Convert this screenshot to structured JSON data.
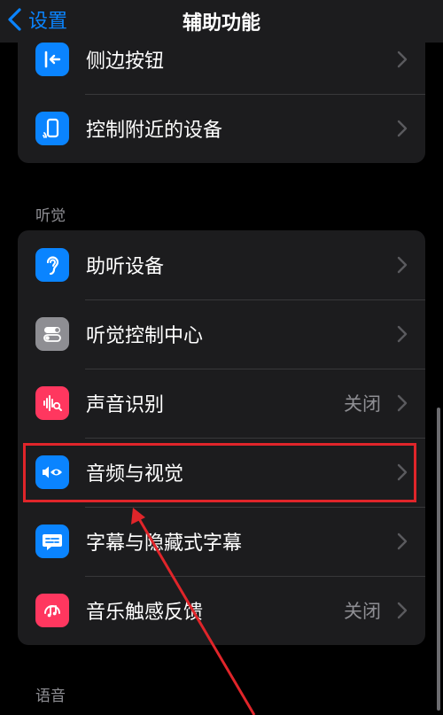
{
  "navbar": {
    "back_label": "设置",
    "title": "辅助功能"
  },
  "group_top": [
    {
      "label": "侧边按钮",
      "value": "",
      "icon": "side-button-icon",
      "color": "#0a84ff"
    },
    {
      "label": "控制附近的设备",
      "value": "",
      "icon": "nearby-devices-icon",
      "color": "#0a84ff"
    }
  ],
  "hearing": {
    "header": "听觉",
    "items": [
      {
        "label": "助听设备",
        "value": "",
        "icon": "ear-icon",
        "color": "#0a84ff"
      },
      {
        "label": "听觉控制中心",
        "value": "",
        "icon": "toggles-icon",
        "color": "#8e8e93"
      },
      {
        "label": "声音识别",
        "value": "关闭",
        "icon": "sound-wave-icon",
        "color": "#ff375f"
      },
      {
        "label": "音频与视觉",
        "value": "",
        "icon": "speaker-eye-icon",
        "color": "#0a84ff"
      },
      {
        "label": "字幕与隐藏式字幕",
        "value": "",
        "icon": "caption-icon",
        "color": "#0a84ff"
      },
      {
        "label": "音乐触感反馈",
        "value": "关闭",
        "icon": "music-haptics-icon",
        "color": "#ff375f"
      }
    ]
  },
  "speech": {
    "header": "语音"
  },
  "annotation": {
    "highlight_color": "#e0252a",
    "highlight_target": "音频与视觉"
  }
}
